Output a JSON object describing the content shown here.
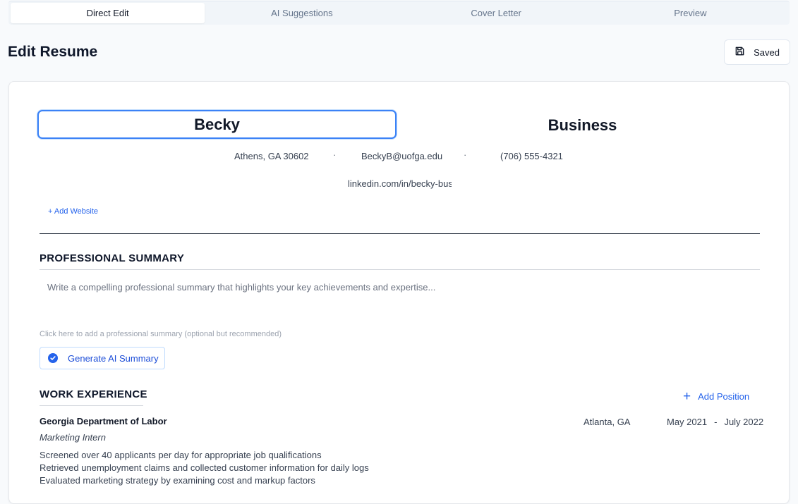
{
  "tabs": [
    {
      "label": "Direct Edit",
      "active": true
    },
    {
      "label": "AI Suggestions",
      "active": false
    },
    {
      "label": "Cover Letter",
      "active": false
    },
    {
      "label": "Preview",
      "active": false
    }
  ],
  "header": {
    "title": "Edit Resume",
    "saved_label": "Saved",
    "saved_icon": "save-icon"
  },
  "resume": {
    "first_name": "Becky",
    "last_name": "Business",
    "location": "Athens, GA 30602",
    "email": "BeckyB@uofga.edu",
    "phone": "(706) 555-4321",
    "linkedin": "linkedin.com/in/becky-bus",
    "separator": "·",
    "add_website_label": "+ Add Website"
  },
  "summary": {
    "heading": "PROFESSIONAL SUMMARY",
    "placeholder": "Write a compelling professional summary that highlights your key achievements and expertise...",
    "hint": "Click here to add a professional summary (optional but recommended)",
    "generate_label": "Generate AI Summary"
  },
  "experience": {
    "heading": "WORK EXPERIENCE",
    "add_position_label": "Add Position",
    "jobs": [
      {
        "company": "Georgia Department of Labor",
        "location": "Atlanta, GA",
        "start": "May 2021",
        "dash": "-",
        "end": "July 2022",
        "title": "Marketing Intern",
        "bullets": [
          "Screened over 40 applicants per day for appropriate job qualifications",
          "Retrieved unemployment claims and collected customer information for daily logs",
          "Evaluated marketing strategy by examining cost and markup factors"
        ]
      }
    ]
  },
  "colors": {
    "accent": "#2563eb",
    "focus_ring": "#3b82f6"
  }
}
